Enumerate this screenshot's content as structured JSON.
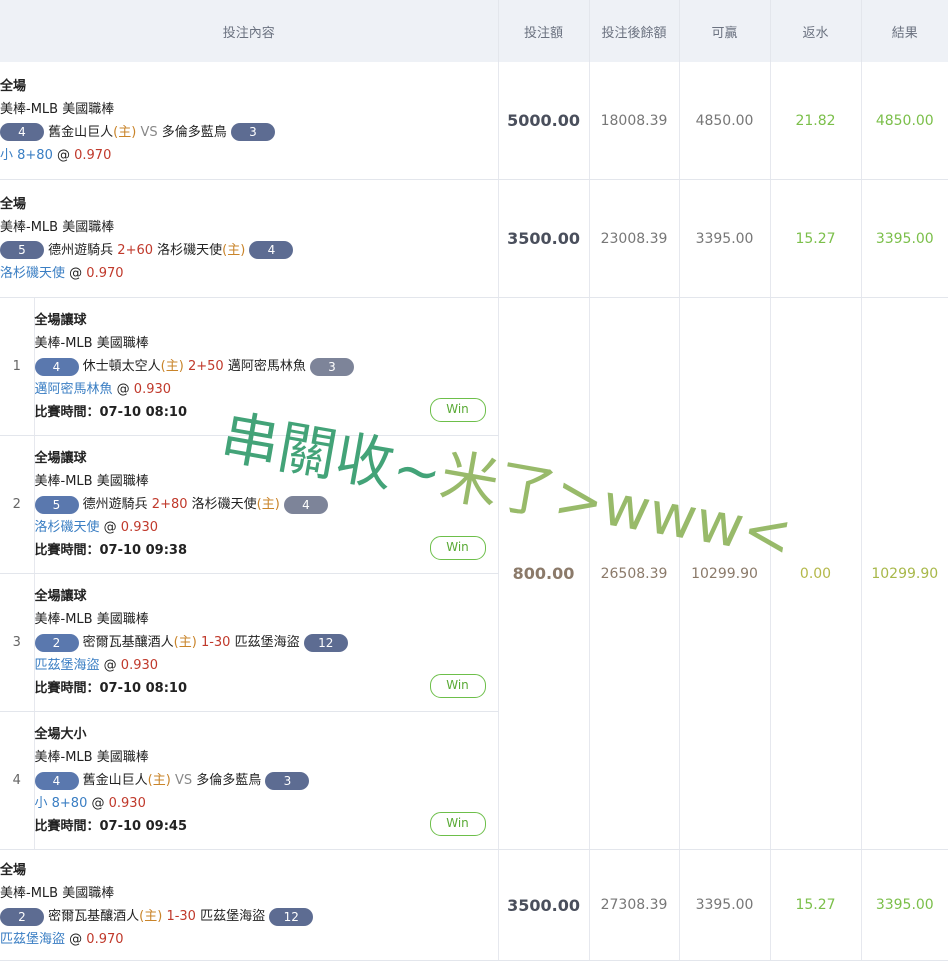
{
  "headers": {
    "content": "投注內容",
    "stake": "投注額",
    "balance": "投注後餘額",
    "to_win": "可贏",
    "rebate": "返水",
    "result": "結果"
  },
  "bets": [
    {
      "market": "全場",
      "league": "美棒-MLB 美國職棒",
      "left_num": "4",
      "home": "舊金山巨人",
      "home_tag": "(主)",
      "mid": "VS",
      "away": "多倫多藍鳥",
      "right_num": "3",
      "pick": "小 8+80",
      "at": "@",
      "odds": "0.970",
      "stake": "5000.00",
      "balance": "18008.39",
      "to_win": "4850.00",
      "rebate": "21.82",
      "result": "4850.00"
    },
    {
      "market": "全場",
      "league": "美棒-MLB 美國職棒",
      "left_num": "5",
      "home": "德州遊騎兵",
      "handicap": "2+60",
      "away": "洛杉磯天使",
      "away_tag": "(主)",
      "right_num": "4",
      "pick": "洛杉磯天使",
      "at": "@",
      "odds": "0.970",
      "stake": "3500.00",
      "balance": "23008.39",
      "to_win": "3395.00",
      "rebate": "15.27",
      "result": "3395.00"
    },
    {
      "market": "全場",
      "league": "美棒-MLB 美國職棒",
      "left_num": "2",
      "home": "密爾瓦基釀酒人",
      "home_tag": "(主)",
      "handicap": "1-30",
      "away": "匹茲堡海盜",
      "right_num": "12",
      "pick": "匹茲堡海盜",
      "at": "@",
      "odds": "0.970",
      "stake": "3500.00",
      "balance": "27308.39",
      "to_win": "3395.00",
      "rebate": "15.27",
      "result": "3395.00"
    }
  ],
  "parlay": {
    "stake": "800.00",
    "balance": "26508.39",
    "to_win": "10299.90",
    "rebate": "0.00",
    "result": "10299.90",
    "time_label": "比賽時間：",
    "win_label": "Win",
    "legs": [
      {
        "idx": "1",
        "market": "全場讓球",
        "league": "美棒-MLB 美國職棒",
        "left_num": "4",
        "home": "休士頓太空人",
        "home_tag": "(主)",
        "handicap": "2+50",
        "away": "邁阿密馬林魚",
        "right_num": "3",
        "pick": "邁阿密馬林魚",
        "odds": "0.930",
        "time": "07-10 08:10"
      },
      {
        "idx": "2",
        "market": "全場讓球",
        "league": "美棒-MLB 美國職棒",
        "left_num": "5",
        "home": "德州遊騎兵",
        "handicap": "2+80",
        "away": "洛杉磯天使",
        "away_tag": "(主)",
        "right_num": "4",
        "pick": "洛杉磯天使",
        "odds": "0.930",
        "time": "07-10 09:38"
      },
      {
        "idx": "3",
        "market": "全場讓球",
        "league": "美棒-MLB 美國職棒",
        "left_num": "2",
        "home": "密爾瓦基釀酒人",
        "home_tag": "(主)",
        "handicap": "1-30",
        "away": "匹茲堡海盜",
        "right_num": "12",
        "pick": "匹茲堡海盜",
        "odds": "0.930",
        "time": "07-10 08:10"
      },
      {
        "idx": "4",
        "market": "全場大小",
        "league": "美棒-MLB 美國職棒",
        "left_num": "4",
        "home": "舊金山巨人",
        "home_tag": "(主)",
        "mid": "VS",
        "away": "多倫多藍鳥",
        "right_num": "3",
        "pick": "小 8+80",
        "odds": "0.930",
        "time": "07-10 09:45"
      }
    ]
  },
  "watermark": {
    "part1": "串關收~",
    "part2": "米了>www<"
  }
}
